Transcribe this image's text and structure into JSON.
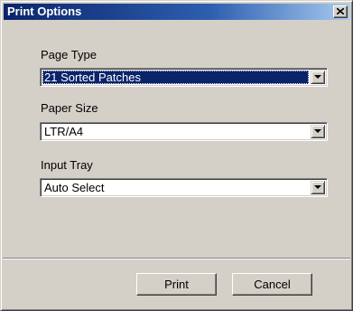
{
  "window": {
    "title": "Print Options",
    "close_icon": "close-icon"
  },
  "fields": {
    "page_type": {
      "label": "Page Type",
      "value": "21 Sorted Patches"
    },
    "paper_size": {
      "label": "Paper Size",
      "value": "LTR/A4"
    },
    "input_tray": {
      "label": "Input Tray",
      "value": "Auto Select"
    }
  },
  "buttons": {
    "print_label": "Print",
    "cancel_label": "Cancel"
  },
  "colors": {
    "title_bar": "#0a246a",
    "face": "#d4d0c8",
    "selection": "#0a246a"
  }
}
